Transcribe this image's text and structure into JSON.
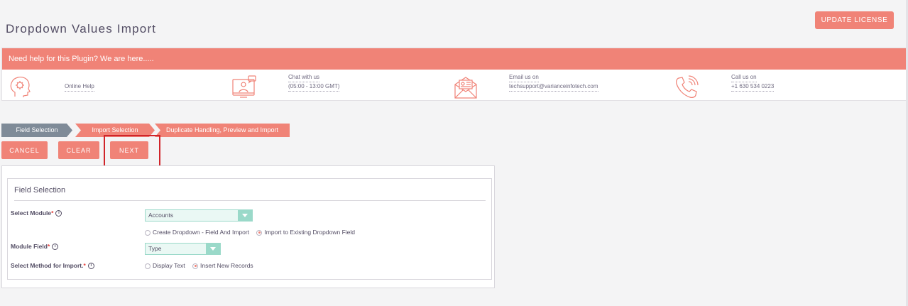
{
  "page": {
    "title": "Dropdown Values Import",
    "update_license": "UPDATE LICENSE"
  },
  "help": {
    "banner": "Need help for this Plugin? We are here.....",
    "items": [
      {
        "icon": "brain-gear-icon",
        "lines": [
          "Online Help"
        ]
      },
      {
        "icon": "chat-monitor-icon",
        "lines": [
          "Chat with us",
          "(05:00 - 13:00 GMT)"
        ]
      },
      {
        "icon": "email-icon",
        "lines": [
          "Email us on",
          "techsupport@varianceinfotech.com"
        ]
      },
      {
        "icon": "phone-icon",
        "lines": [
          "Call us on",
          "+1 630 534 0223"
        ]
      }
    ]
  },
  "steps": [
    "Field Selection",
    "Import Selection",
    "Duplicate Handling, Preview and Import"
  ],
  "actions": {
    "cancel": "CANCEL",
    "clear": "CLEAR",
    "next": "NEXT"
  },
  "form": {
    "legend": "Field Selection",
    "module_label": "Select Module",
    "module_value": "Accounts",
    "dropdown_mode_options": [
      "Create Dropdown - Field And Import",
      "Import to Existing Dropdown Field"
    ],
    "dropdown_mode_selected": "Import to Existing Dropdown Field",
    "module_field_label": "Module Field",
    "module_field_value": "Type",
    "method_label": "Select Method for Import.",
    "method_options": [
      "Display Text",
      "Insert New Records"
    ],
    "method_selected": "Insert New Records",
    "required_mark": "*",
    "info_glyph": "i"
  },
  "colors": {
    "accent": "#f08377",
    "step_done": "#7f8b98",
    "select_border": "#9ad9c9",
    "highlight": "#d0242a"
  }
}
